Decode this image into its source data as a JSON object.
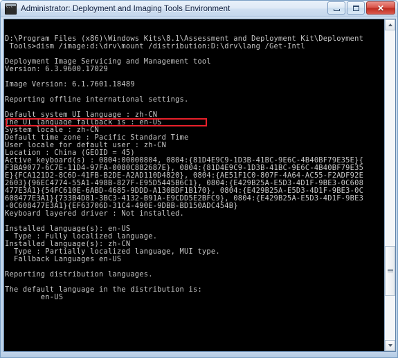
{
  "window": {
    "title": "Administrator: Deployment and Imaging Tools Environment",
    "system_icon": "console-icon",
    "controls": {
      "minimize_label": "Minimize",
      "maximize_label": "Maximize",
      "close_label": "Close",
      "close_glyph": "✕"
    }
  },
  "colors": {
    "console_background": "#000000",
    "console_text": "#c8c8c8",
    "annotation_red": "#e8202a",
    "titlebar_text": "#102040"
  },
  "annotation": {
    "type": "red-rectangle-highlight",
    "highlighted_text": "Default time zone : Pacific Standard Time"
  },
  "scrollbar": {
    "up_arrow": "scroll-up-icon",
    "down_arrow": "scroll-down-icon",
    "thumb": "scrollbar-thumb"
  },
  "console": {
    "lines": [
      "D:\\Program Files (x86)\\Windows Kits\\8.1\\Assessment and Deployment Kit\\Deployment",
      " Tools>dism /image:d:\\drv\\mount /distribution:D:\\drv\\lang /Get-Intl",
      "",
      "Deployment Image Servicing and Management tool",
      "Version: 6.3.9600.17029",
      "",
      "Image Version: 6.1.7601.18489",
      "",
      "Reporting offline international settings.",
      "",
      "Default system UI language : zh-CN",
      "The UI language fallback is : en-US",
      "System locale : zh-CN",
      "Default time zone : Pacific Standard Time",
      "User locale for default user : zh-CN",
      "Location : China (GEOID = 45)",
      "Active keyboard(s) : 0804:00000804, 0804:{81D4E9C9-1D3B-41BC-9E6C-4B40BF79E35E}{",
      "F3BA9077-6C7E-11D4-97FA-0080C882687E}, 0804:{81D4E9C9-1D3B-41BC-9E6C-4B40BF79E35",
      "E}{FCA121D2-8C6D-41FB-B2DE-A2AD110D4820}, 0804:{AE51F1C0-807F-4A64-AC55-F2ADF92E",
      "2603}{96EC4774-55A1-498B-827F-E95D5445B6C1}, 0804:{E429B25A-E5D3-4D1F-9BE3-0C608",
      "477E3A1}{54FC610E-6ABD-4685-9DDD-A130BDF1B170}, 0804:{E429B25A-E5D3-4D1F-9BE3-0C",
      "608477E3A1}{733B4D81-3BC3-4132-B91A-E9CDD5E2BFC9}, 0804:{E429B25A-E5D3-4D1F-9BE3",
      "-0C608477E3A1}{EF63706D-31C4-490E-9DBB-BD150ADC454B}",
      "Keyboard layered driver : Not installed.",
      "",
      "Installed language(s): en-US",
      "  Type : Fully localized language.",
      "Installed language(s): zh-CN",
      "  Type : Partially localized language, MUI type.",
      "  Fallback Languages en-US",
      "",
      "Reporting distribution languages.",
      "",
      "The default language in the distribution is:",
      "        en-US"
    ]
  }
}
